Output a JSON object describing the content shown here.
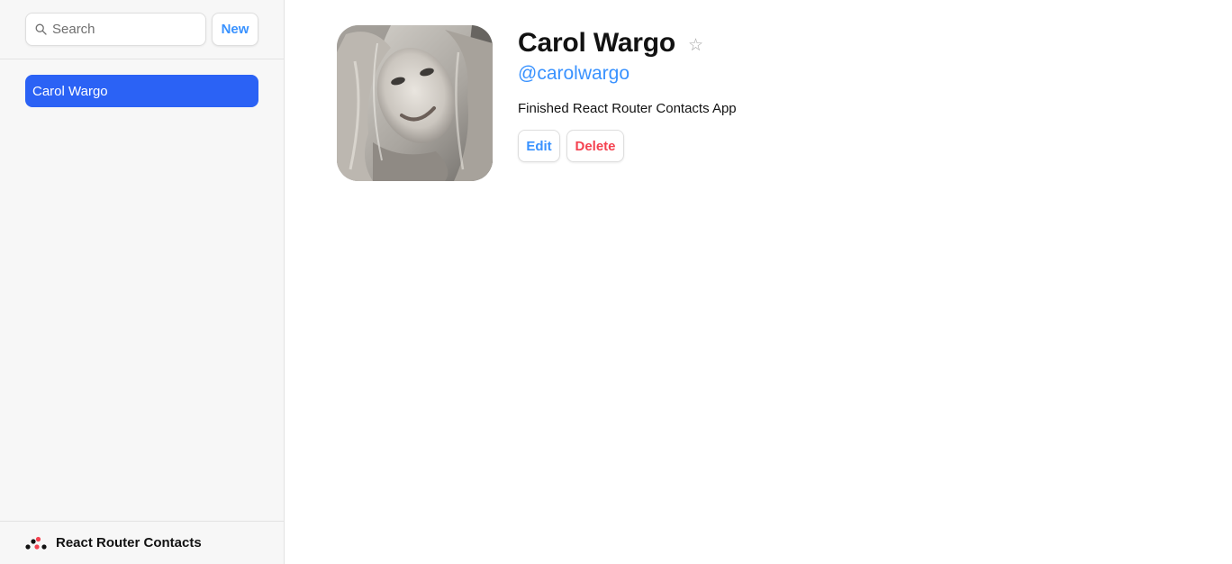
{
  "sidebar": {
    "search": {
      "placeholder": "Search",
      "value": ""
    },
    "new_label": "New",
    "contacts": [
      {
        "name": "Carol Wargo",
        "active": true
      }
    ],
    "footer_title": "React Router Contacts"
  },
  "contact": {
    "name": "Carol Wargo",
    "favorite": false,
    "star_glyph": "☆",
    "handle": "@carolwargo",
    "notes": "Finished React Router Contacts App",
    "edit_label": "Edit",
    "delete_label": "Delete"
  },
  "colors": {
    "accent": "#3992ff",
    "active_item": "#2b62f5",
    "danger": "#f44250",
    "logo_red": "#f44250"
  }
}
